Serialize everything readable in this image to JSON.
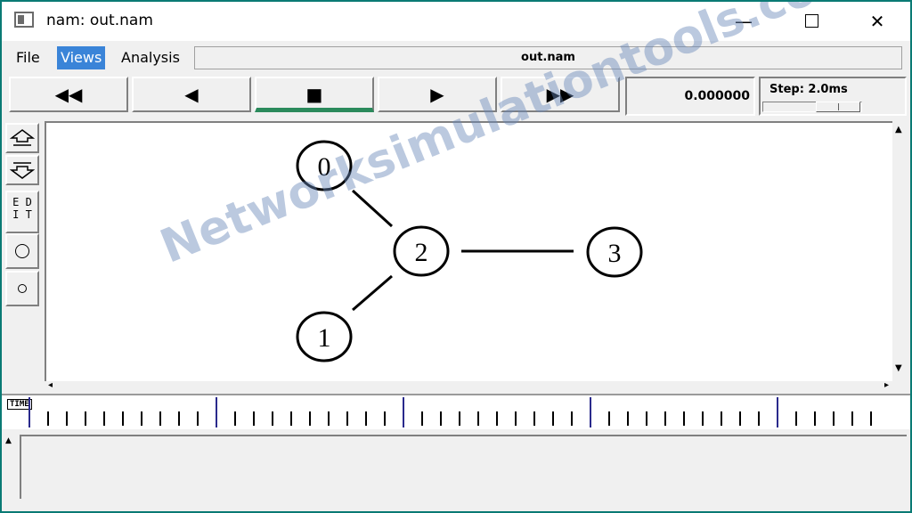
{
  "window": {
    "title": "nam: out.nam"
  },
  "menu": {
    "file": "File",
    "views": "Views",
    "analysis": "Analysis"
  },
  "file_label": "out.nam",
  "playback": {
    "rewind": "◀◀",
    "back": "◀",
    "stop": "■",
    "play": "▶",
    "fast_forward": "▶▶",
    "time": "0.000000",
    "step": "Step: 2.0ms"
  },
  "tools": {
    "edit": "E D\nI T"
  },
  "timeline": {
    "label": "TIME"
  },
  "network": {
    "nodes": [
      "0",
      "2",
      "3",
      "1"
    ]
  },
  "watermark": "Networksimulationtools.com"
}
